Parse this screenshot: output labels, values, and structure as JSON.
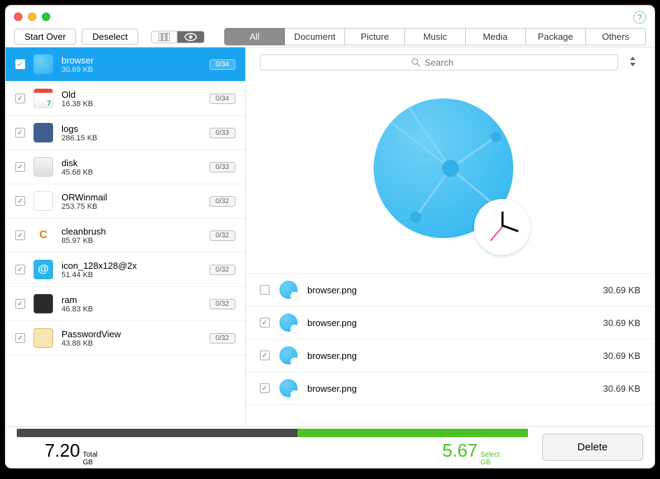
{
  "toolbar": {
    "start_over": "Start Over",
    "deselect": "Deselect"
  },
  "tabs": [
    {
      "label": "All",
      "active": true
    },
    {
      "label": "Document",
      "active": false
    },
    {
      "label": "Picture",
      "active": false
    },
    {
      "label": "Music",
      "active": false
    },
    {
      "label": "Media",
      "active": false
    },
    {
      "label": "Package",
      "active": false
    },
    {
      "label": "Others",
      "active": false
    }
  ],
  "search": {
    "placeholder": "Search"
  },
  "sidebar": [
    {
      "name": "browser",
      "size": "30.69 KB",
      "badge": "0/34",
      "checked": true,
      "selected": true,
      "icon": "globe"
    },
    {
      "name": "Old",
      "size": "16.38 KB",
      "badge": "0/34",
      "checked": true,
      "selected": false,
      "icon": "cal"
    },
    {
      "name": "logs",
      "size": "286.15 KB",
      "badge": "0/33",
      "checked": true,
      "selected": false,
      "icon": "logs"
    },
    {
      "name": "disk",
      "size": "45.68 KB",
      "badge": "0/33",
      "checked": true,
      "selected": false,
      "icon": "disk"
    },
    {
      "name": "ORWinmail",
      "size": "253.75 KB",
      "badge": "0/32",
      "checked": true,
      "selected": false,
      "icon": "doc"
    },
    {
      "name": "cleanbrush",
      "size": "85.97 KB",
      "badge": "0/32",
      "checked": true,
      "selected": false,
      "icon": "brush"
    },
    {
      "name": "icon_128x128@2x",
      "size": "51.44 KB",
      "badge": "0/32",
      "checked": true,
      "selected": false,
      "icon": "at"
    },
    {
      "name": "ram",
      "size": "46.83 KB",
      "badge": "0/32",
      "checked": true,
      "selected": false,
      "icon": "ram"
    },
    {
      "name": "PasswordView",
      "size": "43.88 KB",
      "badge": "0/32",
      "checked": true,
      "selected": false,
      "icon": "pwd"
    }
  ],
  "files": [
    {
      "name": "browser.png",
      "size": "30.69 KB",
      "checked": false
    },
    {
      "name": "browser.png",
      "size": "30.69 KB",
      "checked": true
    },
    {
      "name": "browser.png",
      "size": "30.69 KB",
      "checked": true
    },
    {
      "name": "browser.png",
      "size": "30.69 KB",
      "checked": true
    }
  ],
  "footer": {
    "total_value": "7.20",
    "total_unit_line1": "Total",
    "total_unit_line2": "GB",
    "select_value": "5.67",
    "select_unit_line1": "Select",
    "select_unit_line2": "GB",
    "delete_label": "Delete"
  }
}
